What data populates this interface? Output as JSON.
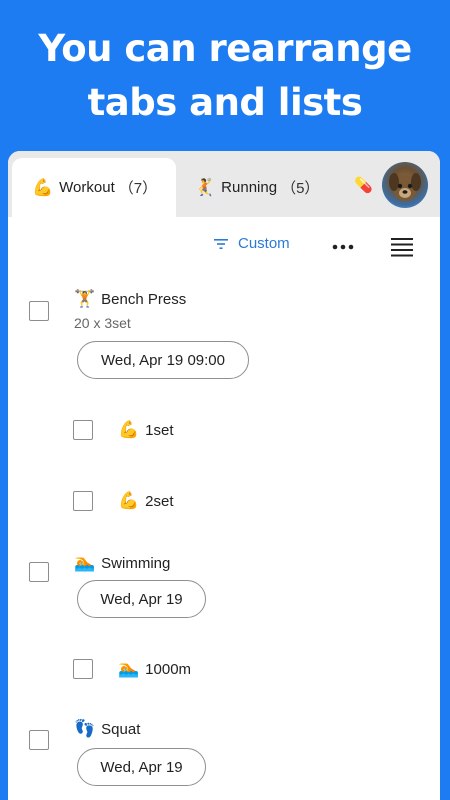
{
  "headline": {
    "line1": "You can rearrange",
    "line2": "tabs and lists"
  },
  "tabs": [
    {
      "emoji": "💪",
      "label": "Workout",
      "count": "（7）",
      "active": true
    },
    {
      "emoji": "🤾",
      "label": "Running",
      "count": "（5）",
      "active": false
    }
  ],
  "extra_tab_icon": "💊",
  "avatar_icon": "dog-avatar",
  "toolbar": {
    "sort_label": "Custom",
    "sort_icon": "filter-lines-icon",
    "more_icon": "more-dots-icon",
    "menu_icon": "list-menu-icon",
    "accent_color": "#2a7bd8"
  },
  "items": [
    {
      "emoji": "🏋",
      "title": "Bench Press",
      "subtitle": "20 x 3set",
      "date": "Wed, Apr 19 09:00"
    },
    {
      "emoji": "💪",
      "title": "1set"
    },
    {
      "emoji": "💪",
      "title": "2set"
    },
    {
      "emoji": "🏊",
      "title": "Swimming",
      "date": "Wed, Apr 19"
    },
    {
      "emoji": "🏊",
      "title": "1000m"
    },
    {
      "emoji": "👣",
      "title": "Squat",
      "date": "Wed, Apr 19"
    }
  ],
  "colors": {
    "background": "#1e7cf2",
    "tabbar": "#e9e9e9"
  }
}
